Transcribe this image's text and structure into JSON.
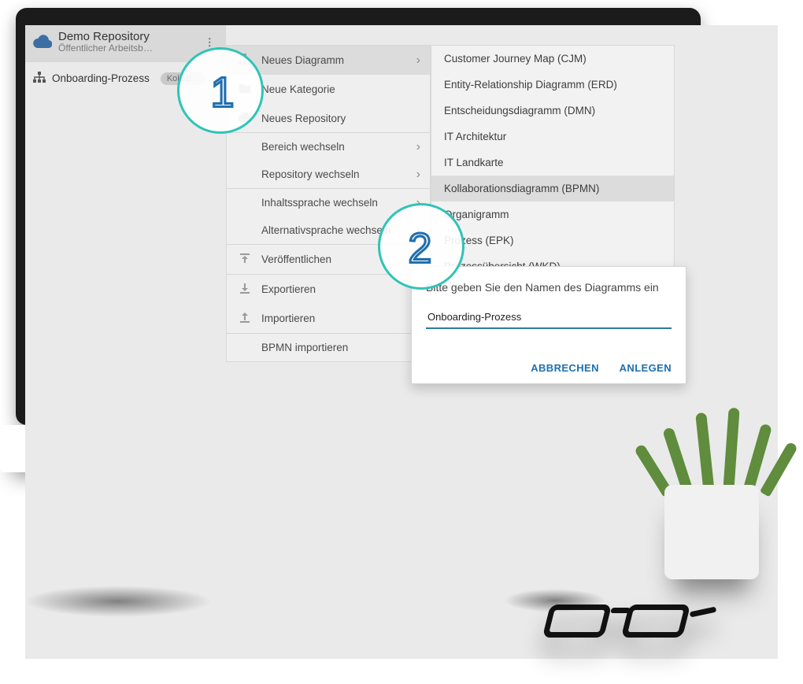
{
  "repo": {
    "title": "Demo Repository",
    "subtitle": "Öffentlicher Arbeitsb…"
  },
  "tree": {
    "item_label": "Onboarding-Prozess",
    "item_tag": "Kollab…"
  },
  "menu1": {
    "new_diagram": "Neues Diagramm",
    "new_category": "Neue Kategorie",
    "new_repo": "Neues Repository",
    "switch_area": "Bereich wechseln",
    "switch_repo": "Repository wechseln",
    "content_lang": "Inhaltssprache wechseln",
    "alt_lang": "Alternativsprache wechseln",
    "publish": "Veröffentlichen",
    "export": "Exportieren",
    "import": "Importieren",
    "bpmn_import": "BPMN importieren"
  },
  "menu2": {
    "cjm": "Customer Journey Map (CJM)",
    "erd": "Entity-Relationship Diagramm (ERD)",
    "dmn": "Entscheidungsdiagramm (DMN)",
    "it_arch": "IT Architektur",
    "it_map": "IT Landkarte",
    "bpmn": "Kollaborationsdiagramm (BPMN)",
    "org": "Organigramm",
    "epk": "Prozess (EPK)",
    "wkd": "Prozessübersicht (WKD)"
  },
  "dialog": {
    "label": "Bitte geben Sie den Namen des Diagramms ein",
    "value": "Onboarding-Prozess",
    "cancel": "ABBRECHEN",
    "create": "ANLEGEN"
  },
  "steps": {
    "one": "1",
    "two": "2"
  }
}
